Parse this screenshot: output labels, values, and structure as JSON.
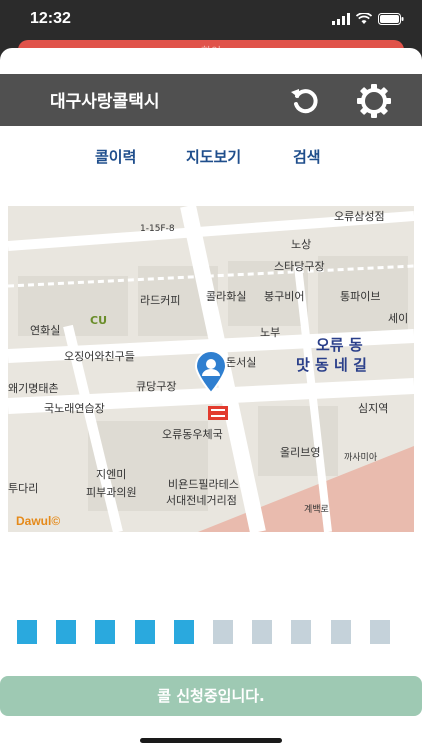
{
  "status": {
    "time": "12:32"
  },
  "banner": {
    "text": "확인"
  },
  "header": {
    "title": "대구사랑콜택시",
    "refresh_icon": "refresh-icon",
    "settings_icon": "gear-icon"
  },
  "tabs": [
    {
      "label": "콜이력"
    },
    {
      "label": "지도보기"
    },
    {
      "label": "검색"
    }
  ],
  "map": {
    "labels": [
      "오류삼성점",
      "노상",
      "스타당구장",
      "라드커피",
      "콜라화실",
      "봉구비어",
      "통파이브",
      "연화실",
      "CU",
      "세이",
      "노부",
      "오징어와친구들",
      "오류 동",
      "맛 동 네 길",
      "돈서실",
      "큐당구장",
      "왜기명태촌",
      "국노래연습장",
      "심지역",
      "오류동우체국",
      "올리브영",
      "까사미아",
      "지엔미",
      "피부과의원",
      "비욘드필라테스",
      "서대전네거리점",
      "투다리",
      "계백로",
      "1-15F-8"
    ],
    "copyright": "Dawul©"
  },
  "progress": {
    "total": 10,
    "filled": 5,
    "filled_color": "#2aa9de",
    "empty_color": "#c5d2da"
  },
  "bottom_button": {
    "label": "콜 신청중입니다."
  }
}
